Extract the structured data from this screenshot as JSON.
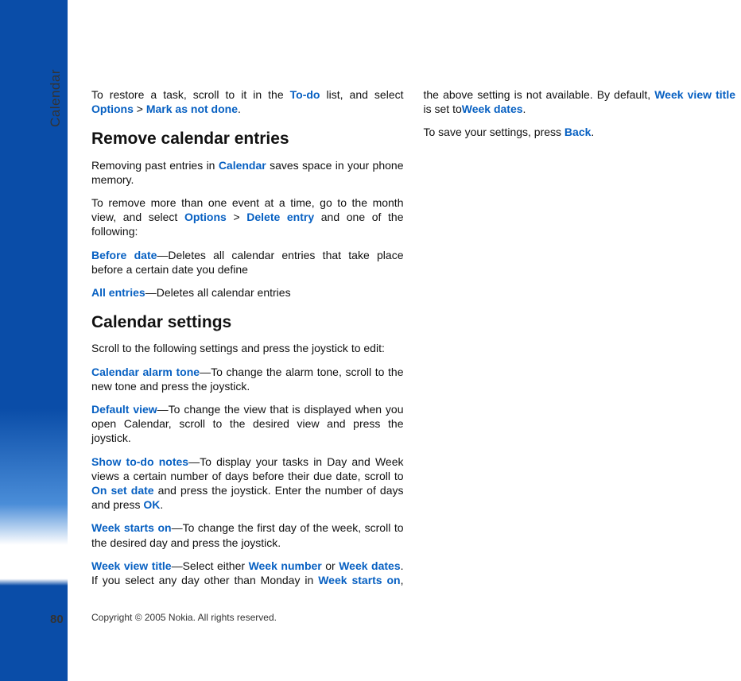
{
  "sidebar": {
    "section_label": "Calendar",
    "page_number": "80"
  },
  "content": {
    "p1_a": "To restore a task, scroll to it in the ",
    "p1_b": "To-do",
    "p1_c": " list, and select ",
    "p1_d": "Options",
    "p1_e": " > ",
    "p1_f": "Mark as not done",
    "p1_g": ".",
    "h1": "Remove calendar entries",
    "p2_a": "Removing past entries in ",
    "p2_b": "Calendar",
    "p2_c": " saves space in your phone memory.",
    "p3_a": "To remove more than one event at a time, go to the month view, and select ",
    "p3_b": "Options",
    "p3_c": " > ",
    "p3_d": "Delete entry",
    "p3_e": " and one of the following:",
    "p4_a": "Before date",
    "p4_b": "—Deletes all calendar entries that take place before a certain date you define",
    "p5_a": "All entries",
    "p5_b": "—Deletes all calendar entries",
    "h2": "Calendar settings",
    "p6": "Scroll to the following settings and press the joystick to edit:",
    "p7_a": "Calendar alarm tone",
    "p7_b": "—To change the alarm tone, scroll to the new tone and press the joystick.",
    "p8_a": "Default view",
    "p8_b": "—To change the view that is displayed when you open Calendar, scroll to the desired view and press the joystick.",
    "p9_a": "Show to-do notes",
    "p9_b": "—To display your tasks in Day and Week views a certain number of days before their due date, scroll to ",
    "p9_c": "On set date",
    "p9_d": " and press the joystick. Enter the number of days and press ",
    "p9_e": "OK",
    "p9_f": ".",
    "p10_a": "Week starts on",
    "p10_b": "—To change the first day of the week, scroll to the desired day and press the joystick.",
    "p11_a": "Week view title",
    "p11_b": "—Select either ",
    "p11_c": "Week number",
    "p11_d": " or ",
    "p11_e": "Week dates",
    "p11_f": ". If you select any day other than Monday in ",
    "p11_g": "Week starts on",
    "p11_h": ", the above setting is not available. By default, ",
    "p11_i": "Week view title",
    "p11_j": " is set to",
    "p11_k": "Week dates",
    "p11_l": ".",
    "p12_a": "To save your settings, press ",
    "p12_b": "Back",
    "p12_c": "."
  },
  "footer": "Copyright © 2005 Nokia. All rights reserved."
}
